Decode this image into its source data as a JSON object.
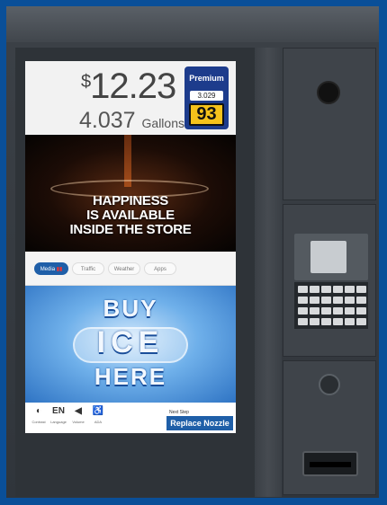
{
  "sale": {
    "amount": "12.23",
    "currency_symbol": "$",
    "volume": "4.037",
    "volume_unit": "Gallons"
  },
  "grade": {
    "name": "Premium",
    "price_per_gallon": "3.029",
    "octane": "93"
  },
  "ad_top": {
    "line1": "HAPPINESS",
    "line2": "IS AVAILABLE",
    "line3": "INSIDE THE STORE"
  },
  "tabs": [
    {
      "label": "Media",
      "active": true
    },
    {
      "label": "Traffic",
      "active": false
    },
    {
      "label": "Weather",
      "active": false
    },
    {
      "label": "Apps",
      "active": false
    }
  ],
  "ad_bottom": {
    "line1": "BUY",
    "line2": "ICE",
    "line3": "HERE"
  },
  "controls": [
    {
      "icon": "contrast-icon",
      "glyph": "◐",
      "label": "Contrast"
    },
    {
      "icon": "language-icon",
      "glyph": "EN",
      "label": "Language"
    },
    {
      "icon": "volume-icon",
      "glyph": "◀",
      "label": "Volume"
    },
    {
      "icon": "accessibility-icon",
      "glyph": "♿",
      "label": "ADA"
    }
  ],
  "next_step": {
    "label": "Next Step",
    "action": "Replace Nozzle"
  },
  "colors": {
    "accent_blue": "#1f5fa8",
    "octane_yellow": "#f5c21b",
    "grade_blue": "#1d3c8c"
  }
}
